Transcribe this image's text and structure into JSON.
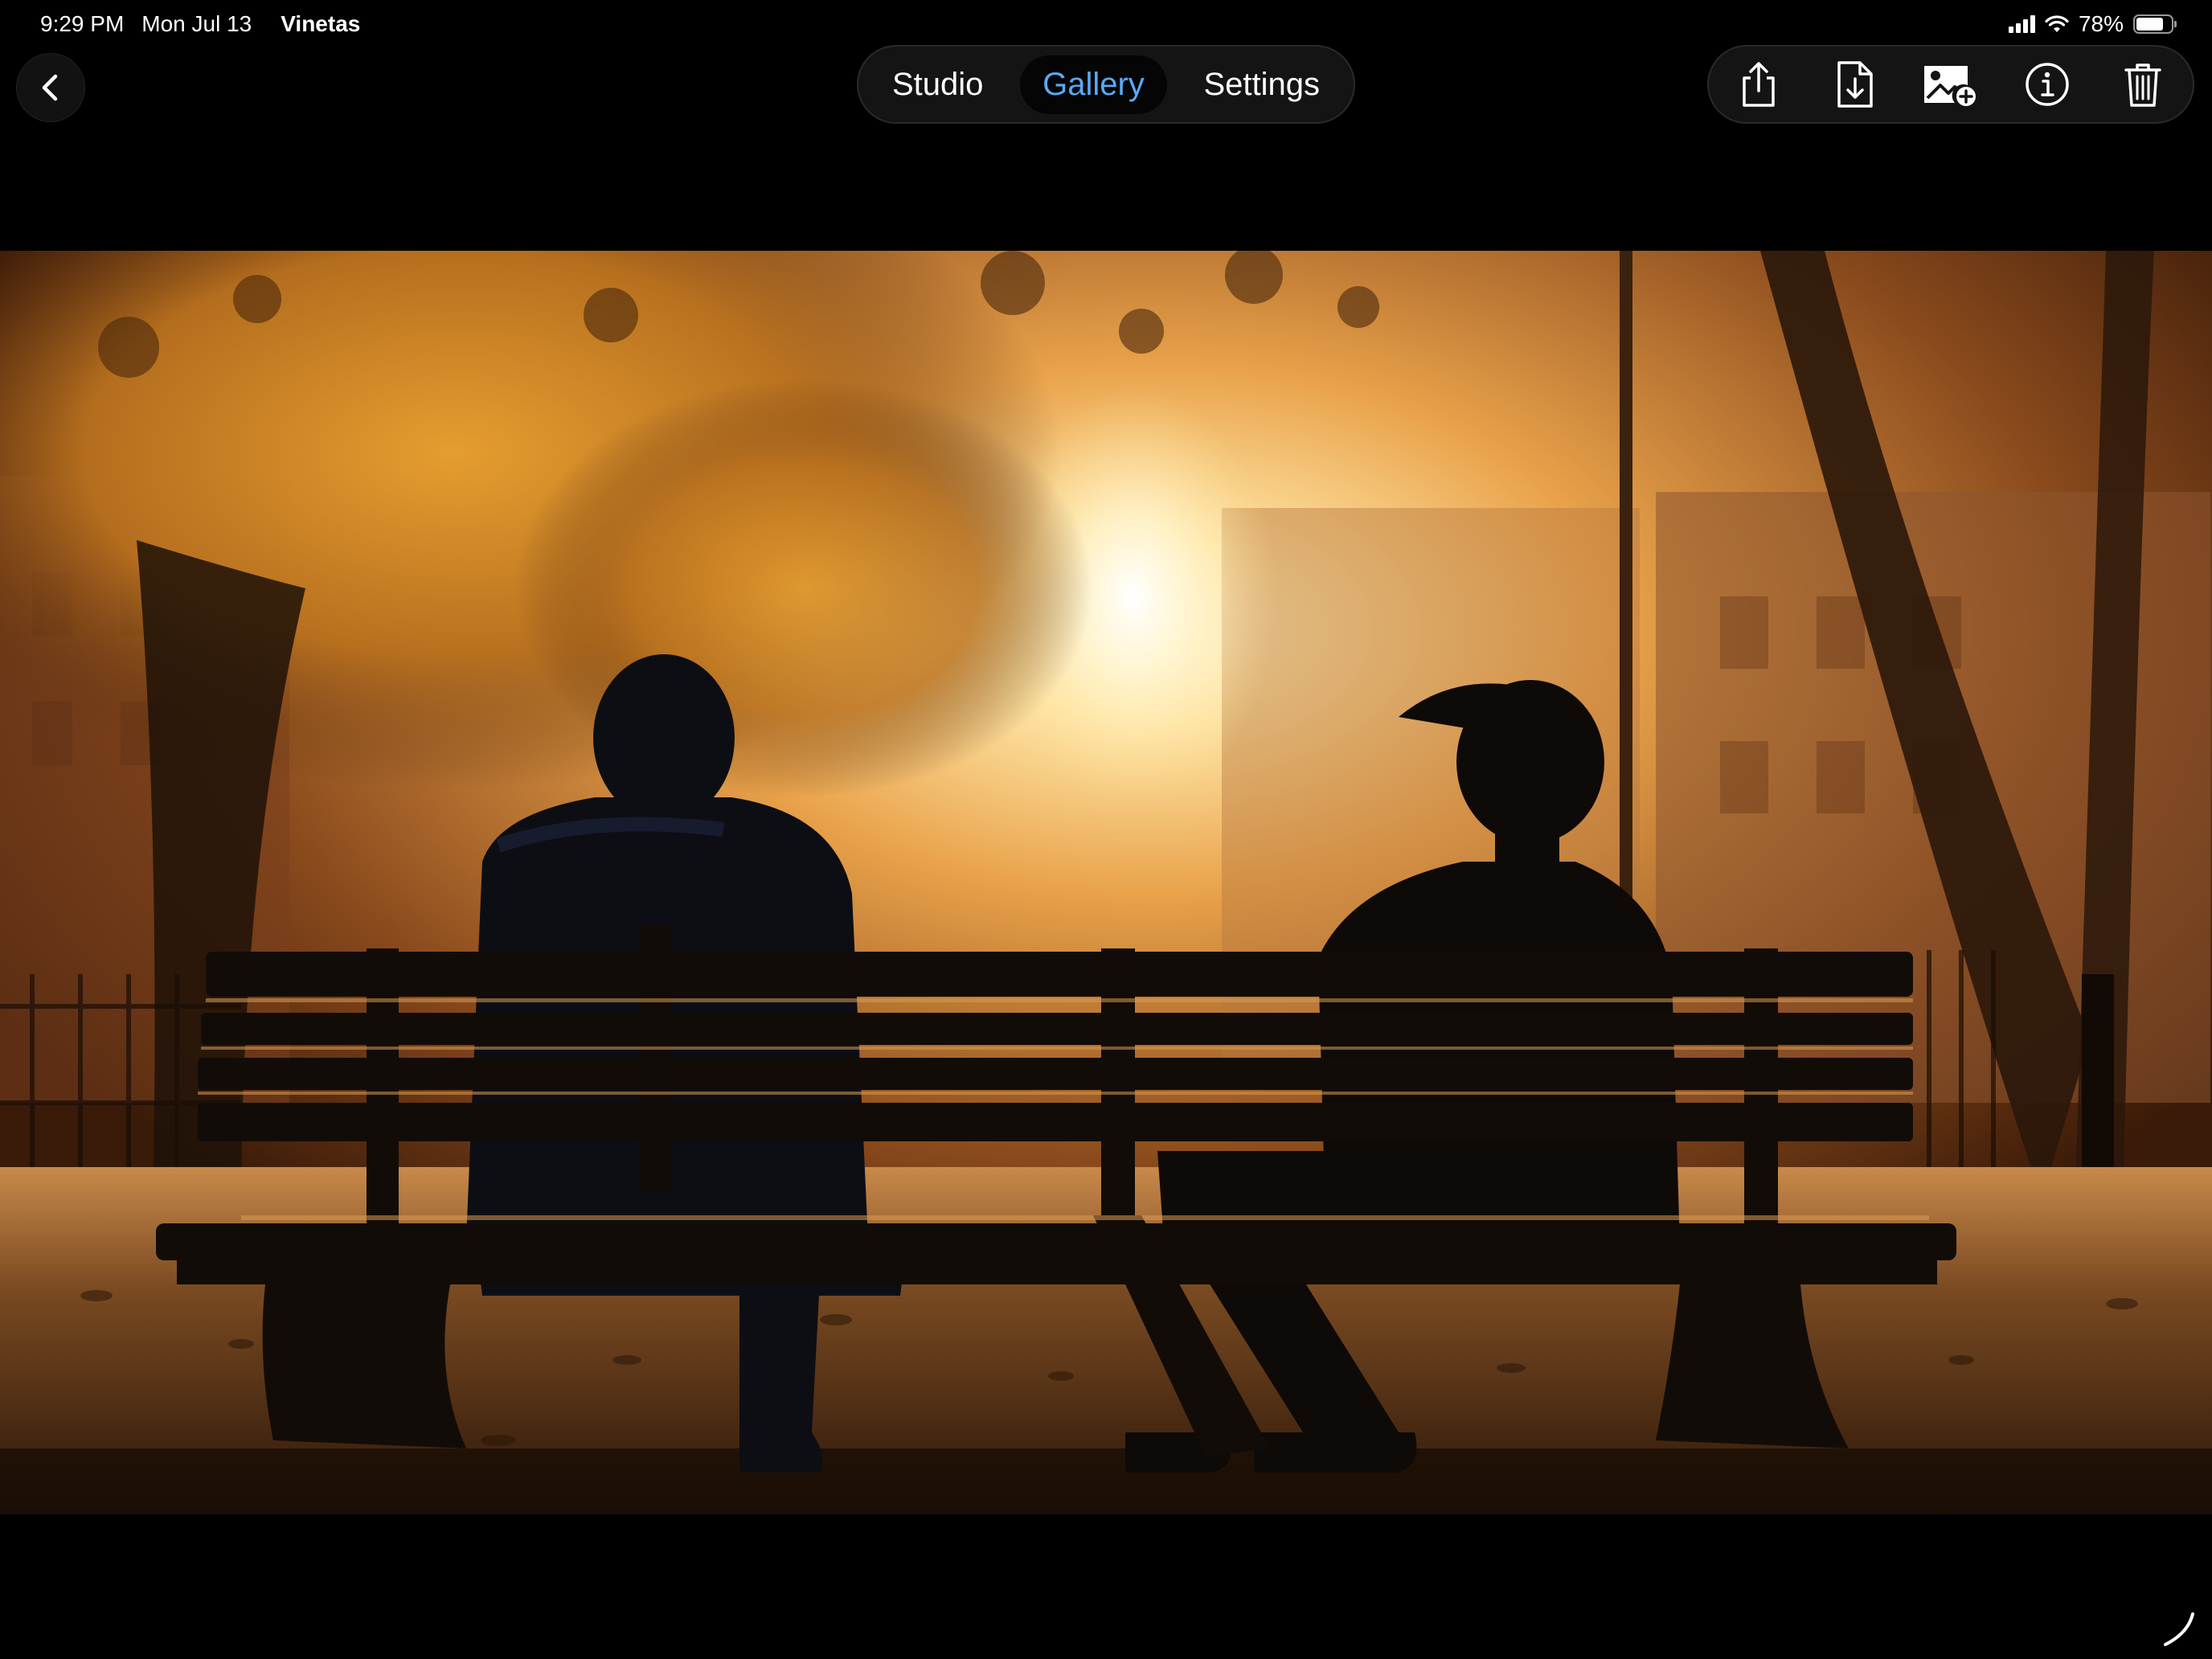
{
  "status_bar": {
    "time": "9:29 PM",
    "date": "Mon Jul 13",
    "app_name": "Vinetas",
    "battery_text": "78%",
    "battery_level": 0.78
  },
  "nav": {
    "tabs": [
      {
        "label": "Studio",
        "active": false
      },
      {
        "label": "Gallery",
        "active": true
      },
      {
        "label": "Settings",
        "active": false
      }
    ],
    "accent_color": "#5aa9f5"
  },
  "toolbar": {
    "icons": [
      "share-icon",
      "export-document-icon",
      "add-image-icon",
      "info-icon",
      "trash-icon"
    ]
  },
  "photo": {
    "subject": "silhouettes-on-park-bench-at-sunset"
  }
}
